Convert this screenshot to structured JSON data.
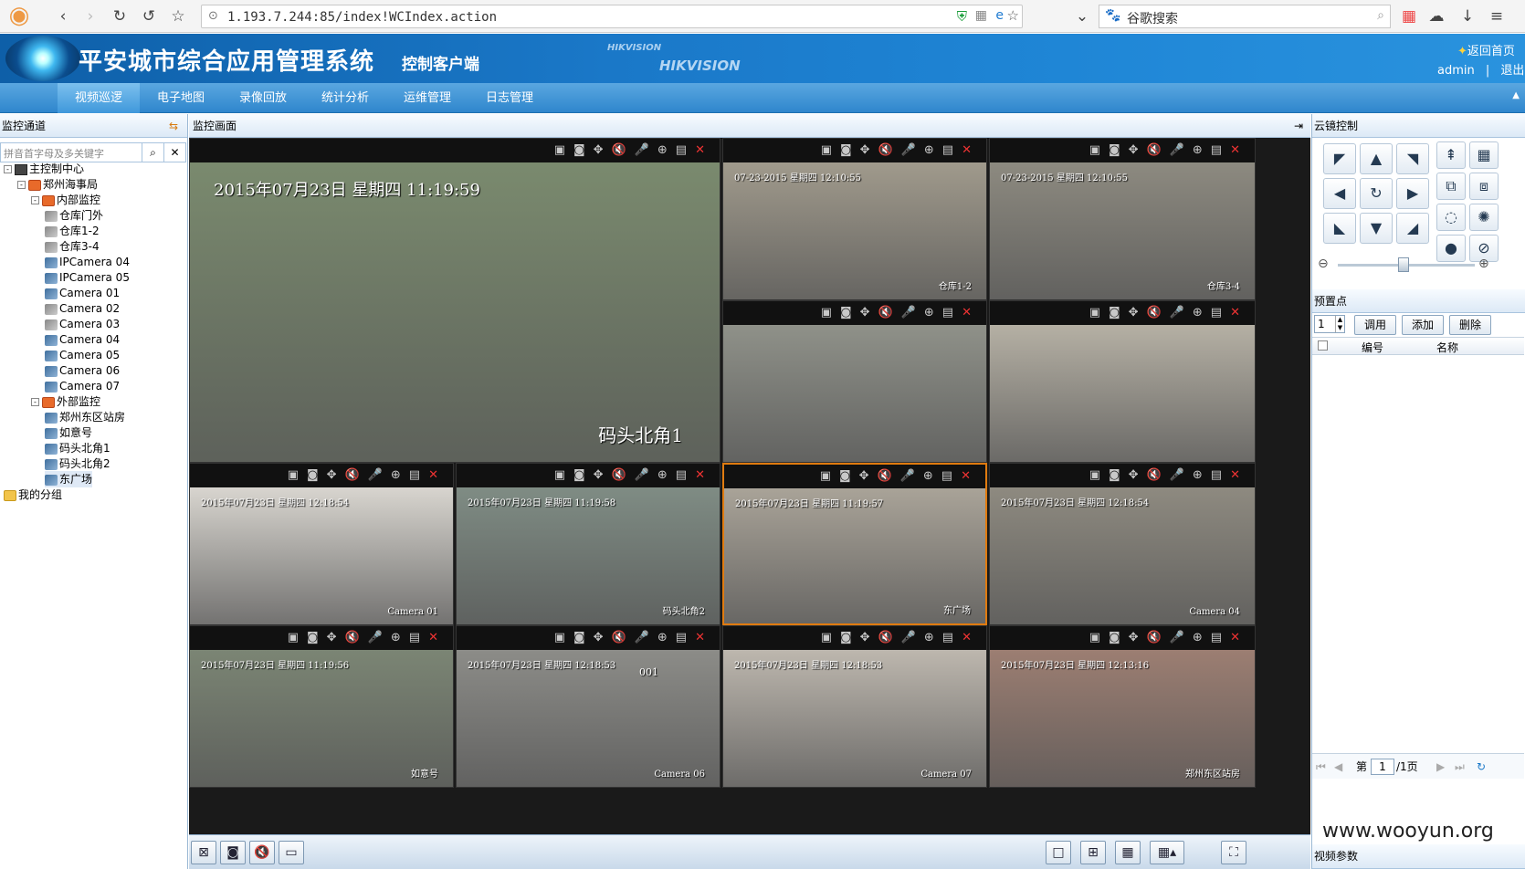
{
  "browser": {
    "url": "1.193.7.244:85/index!WCIndex.action",
    "search_text": "谷歌搜索"
  },
  "header": {
    "title": "平安城市综合应用管理系统",
    "subtitle": "控制客户端",
    "brand_small": "HIKVISION",
    "brand_large": "HIKVISION",
    "home_link": "返回首页",
    "user": "admin",
    "separator": "|",
    "logout": "退出"
  },
  "menu": [
    "视频巡逻",
    "电子地图",
    "录像回放",
    "统计分析",
    "运维管理",
    "日志管理"
  ],
  "left_panel": {
    "title": "监控通道",
    "search_placeholder": "拼音首字母及多关键字",
    "tree": [
      {
        "label": "主控制中心",
        "level": 0,
        "icon": "root",
        "expand": "-"
      },
      {
        "label": "郑州海事局",
        "level": 1,
        "icon": "home",
        "expand": "-"
      },
      {
        "label": "内部监控",
        "level": 2,
        "icon": "home",
        "expand": "-"
      },
      {
        "label": "仓库门外",
        "level": 3,
        "icon": "cam-off"
      },
      {
        "label": "仓库1-2",
        "level": 3,
        "icon": "cam-off"
      },
      {
        "label": "仓库3-4",
        "level": 3,
        "icon": "cam-off"
      },
      {
        "label": "IPCamera 04",
        "level": 3,
        "icon": "cam"
      },
      {
        "label": "IPCamera 05",
        "level": 3,
        "icon": "cam"
      },
      {
        "label": "Camera 01",
        "level": 3,
        "icon": "cam"
      },
      {
        "label": "Camera 02",
        "level": 3,
        "icon": "cam-off"
      },
      {
        "label": "Camera 03",
        "level": 3,
        "icon": "cam-off"
      },
      {
        "label": "Camera 04",
        "level": 3,
        "icon": "cam"
      },
      {
        "label": "Camera 05",
        "level": 3,
        "icon": "cam"
      },
      {
        "label": "Camera 06",
        "level": 3,
        "icon": "cam"
      },
      {
        "label": "Camera 07",
        "level": 3,
        "icon": "cam"
      },
      {
        "label": "外部监控",
        "level": 2,
        "icon": "home",
        "expand": "-"
      },
      {
        "label": "郑州东区站房",
        "level": 3,
        "icon": "cam"
      },
      {
        "label": "如意号",
        "level": 3,
        "icon": "cam"
      },
      {
        "label": "码头北角1",
        "level": 3,
        "icon": "cam"
      },
      {
        "label": "码头北角2",
        "level": 3,
        "icon": "cam"
      },
      {
        "label": "东广场",
        "level": 3,
        "icon": "cam"
      },
      {
        "label": "我的分组",
        "level": 0,
        "icon": "folder"
      }
    ]
  },
  "center": {
    "title": "监控画面",
    "panes": [
      {
        "osd_top": "2015年07月23日 星期四 11:19:59",
        "osd_bottom": "码头北角1",
        "scene": "#7a8a6e"
      },
      {
        "osd_top": "07-23-2015 星期四 12:10:55",
        "osd_bottom": "仓库1-2",
        "scene": "#a09a8c"
      },
      {
        "osd_top": "07-23-2015 星期四 12:10:55",
        "osd_bottom": "仓库3-4",
        "scene": "#8d8a80"
      },
      {
        "osd_top": "",
        "osd_bottom": "",
        "scene": "#8f9189"
      },
      {
        "osd_top": "",
        "osd_bottom": "",
        "scene": "#b5b0a4"
      },
      {
        "osd_top": "2015年07月23日 星期四 12:18:54",
        "osd_bottom": "Camera 01",
        "scene": "#d8d5cf"
      },
      {
        "osd_top": "2015年07月23日 星期四 11:19:58",
        "osd_bottom": "码头北角2",
        "scene": "#7f8c84"
      },
      {
        "osd_top": "2015年07月23日 星期四 11:19:57",
        "osd_bottom": "东广场",
        "scene": "#a9a398"
      },
      {
        "osd_top": "2015年07月23日 星期四 12:18:54",
        "osd_bottom": "Camera 04",
        "scene": "#8e8a80"
      },
      {
        "osd_top": "2015年07月23日 星期四 11:19:56",
        "osd_bottom": "如意号",
        "scene": "#7b8574"
      },
      {
        "osd_top": "2015年07月23日 星期四 12:18:53",
        "osd_bottom": "Camera 06",
        "scene": "#8c8c88"
      },
      {
        "osd_top": "2015年07月23日 星期四 12:18:53",
        "osd_bottom": "Camera 07",
        "scene": "#bdb7ae"
      },
      {
        "osd_top": "2015年07月23日 星期四 12:13:16",
        "osd_bottom": "郑州东区站房",
        "scene": "#9c7e72"
      }
    ],
    "pane_extra": {
      "index": 10,
      "label": "001"
    }
  },
  "right_panel": {
    "ptz_title": "云镜控制",
    "preset_title": "预置点",
    "preset_value": "1",
    "call": "调用",
    "add": "添加",
    "delete": "删除",
    "col_no": "编号",
    "col_name": "名称",
    "page_label": "第",
    "page_value": "1",
    "page_total": "/1页",
    "video_params": "视频参数"
  },
  "watermark": "www.wooyun.org",
  "colors": {
    "accent": "#1a78c8",
    "selected": "#e07b10",
    "close": "#e33333"
  }
}
